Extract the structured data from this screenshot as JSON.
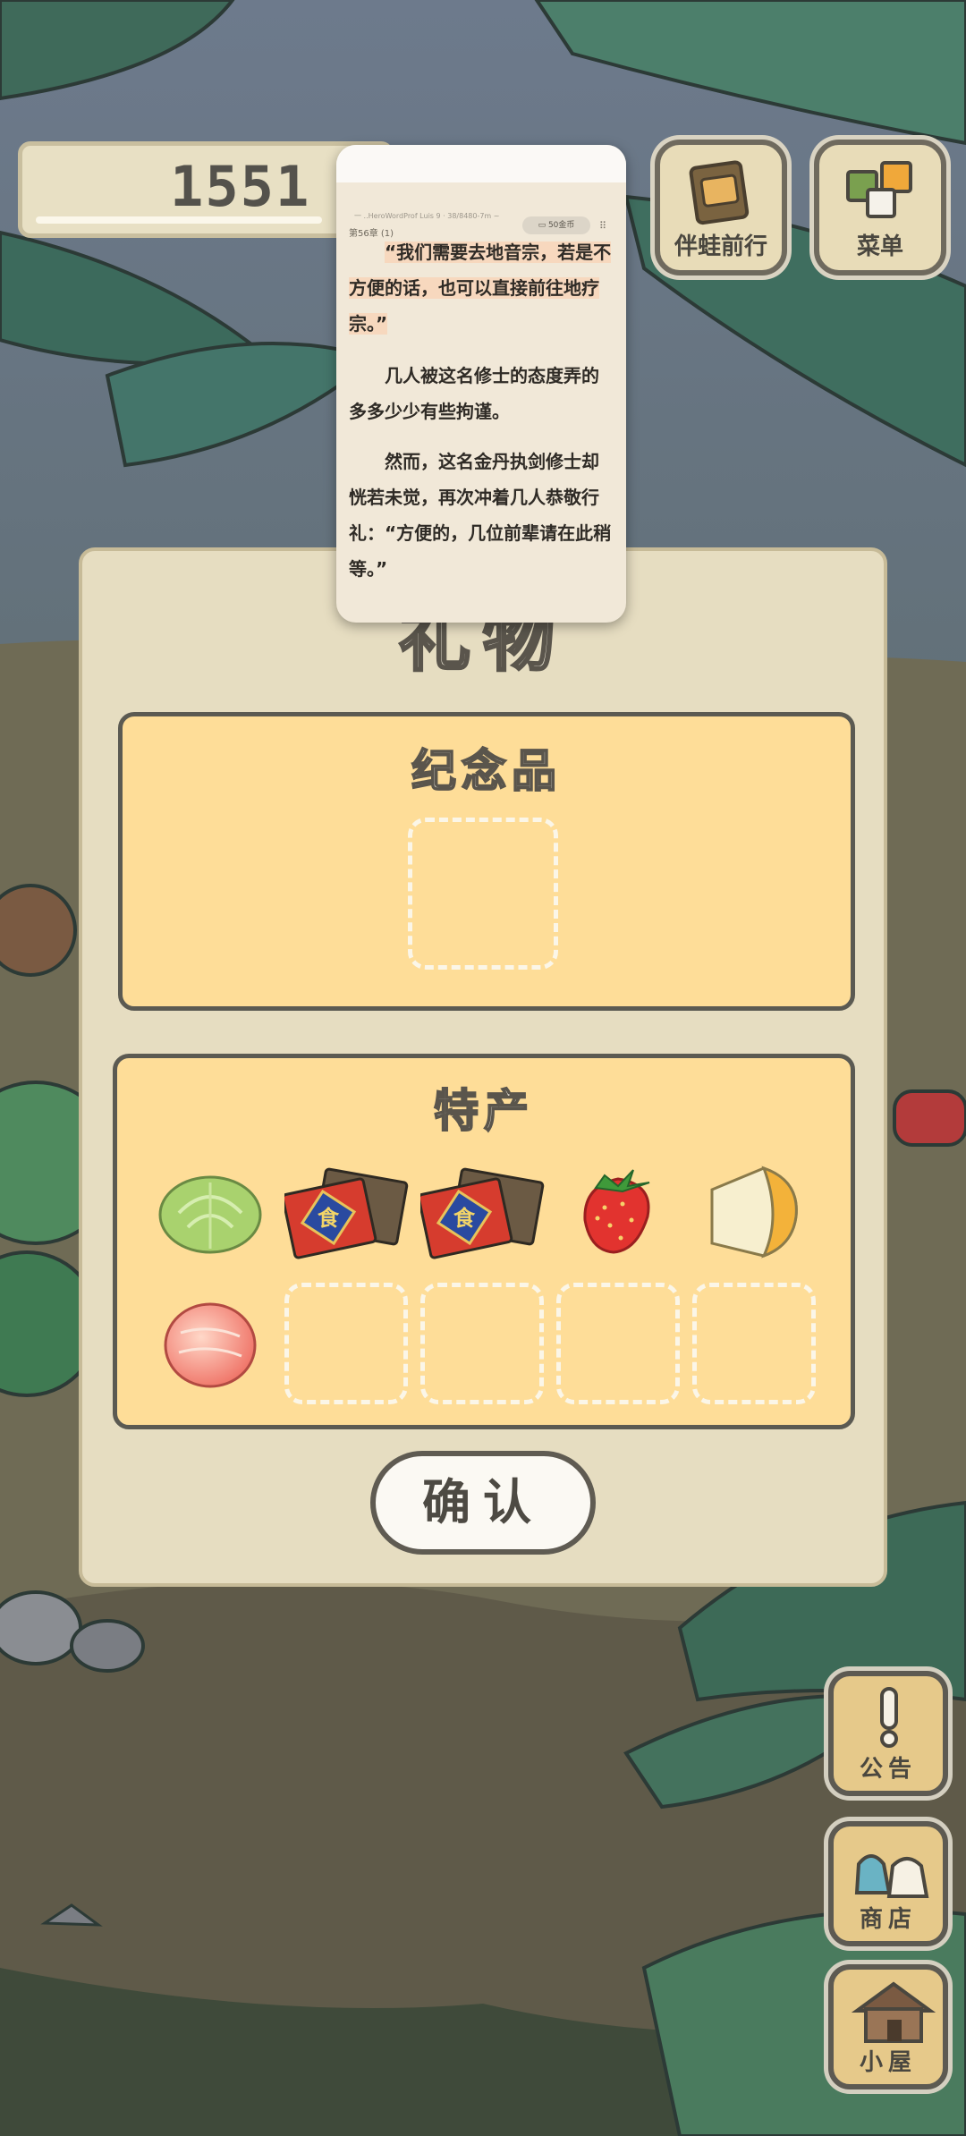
{
  "hud": {
    "clover_count": "1551",
    "top_buttons": [
      {
        "label": "伴蛙前行",
        "icon": "album-icon"
      },
      {
        "label": "菜单",
        "icon": "menu-icon"
      }
    ],
    "side_buttons": [
      {
        "label": "公告",
        "icon": "exclamation-icon"
      },
      {
        "label": "商店",
        "icon": "shop-bags-icon"
      },
      {
        "label": "小屋",
        "icon": "house-icon"
      }
    ]
  },
  "gift_dialog": {
    "title": "礼物",
    "souvenir_section": {
      "title": "纪念品",
      "slots": 1,
      "filled": 0
    },
    "specialty_section": {
      "title": "特产",
      "items": [
        {
          "name": "cabbage-icon"
        },
        {
          "name": "gift-box-icon"
        },
        {
          "name": "gift-box-icon"
        },
        {
          "name": "strawberry-icon"
        },
        {
          "name": "cheese-icon"
        },
        {
          "name": "peach-icon"
        }
      ],
      "empty_slots": 4
    },
    "confirm_label": "确认"
  },
  "reader_overlay": {
    "faded_line": "一 ..HeroWordProf Luis 9 · 38/8480-7m ~",
    "chapter": "第56章 (1)",
    "pill": "▭ 50金币",
    "paragraphs": [
      "“我们需要去地音宗，若是不方便的话，也可以直接前往地疗宗。”",
      "几人被这名修士的态度弄的多多少少有些拘谨。",
      "然而，这名金丹执剑修士却恍若未觉，再次冲着几人恭敬行礼：“方便的，几位前辈请在此稍等。”"
    ]
  },
  "colors": {
    "panel": "#e6ddc1",
    "section_fill": "#fedd98",
    "outline": "#5b5a52",
    "reader_bg": "#f1e8d8",
    "highlight": "#f7d8be"
  }
}
